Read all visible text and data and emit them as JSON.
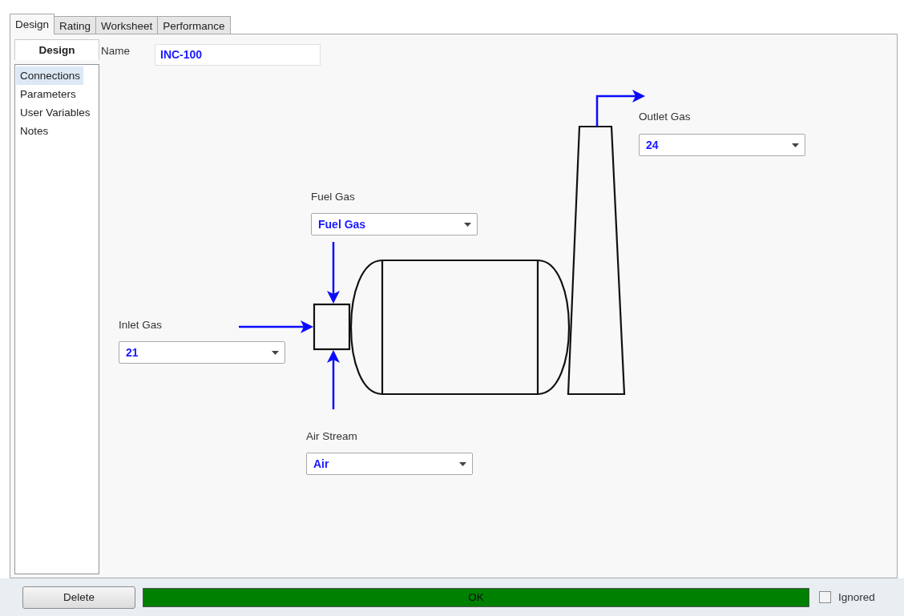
{
  "tabs": [
    {
      "label": "Design",
      "selected": true
    },
    {
      "label": "Rating",
      "selected": false
    },
    {
      "label": "Worksheet",
      "selected": false
    },
    {
      "label": "Performance",
      "selected": false
    }
  ],
  "sidebar": {
    "header": "Design",
    "items": [
      {
        "label": "Connections",
        "selected": true
      },
      {
        "label": "Parameters",
        "selected": false
      },
      {
        "label": "User Variables",
        "selected": false
      },
      {
        "label": "Notes",
        "selected": false
      }
    ]
  },
  "name": {
    "label": "Name",
    "value": "INC-100"
  },
  "connections": [
    {
      "kind": "outlet",
      "label": "Outlet Gas",
      "value": "24"
    },
    {
      "kind": "fuel",
      "label": "Fuel Gas",
      "value": "Fuel Gas"
    },
    {
      "kind": "inlet",
      "label": "Inlet Gas",
      "value": "21"
    },
    {
      "kind": "air",
      "label": "Air Stream",
      "value": "Air"
    }
  ],
  "footer": {
    "delete": "Delete",
    "status": "OK",
    "ignored": {
      "label": "Ignored",
      "checked": false
    }
  }
}
